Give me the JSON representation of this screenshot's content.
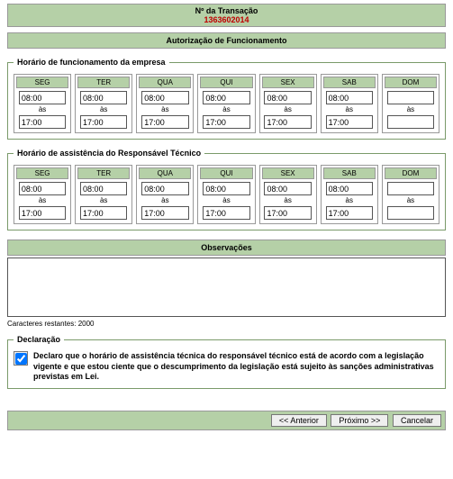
{
  "header": {
    "title": "Nº da Transação",
    "transaction_number": "1363602014"
  },
  "section_title": "Autorização de Funcionamento",
  "schedule_company": {
    "legend": "Horário de funcionamento da empresa",
    "days": [
      "SEG",
      "TER",
      "QUA",
      "QUI",
      "SEX",
      "SAB",
      "DOM"
    ],
    "separator": "às",
    "rows": [
      {
        "start": "08:00",
        "end": "17:00"
      },
      {
        "start": "08:00",
        "end": "17:00"
      },
      {
        "start": "08:00",
        "end": "17:00"
      },
      {
        "start": "08:00",
        "end": "17:00"
      },
      {
        "start": "08:00",
        "end": "17:00"
      },
      {
        "start": "08:00",
        "end": "17:00"
      },
      {
        "start": "",
        "end": ""
      }
    ]
  },
  "schedule_tech": {
    "legend": "Horário de assistência do Responsável Técnico",
    "days": [
      "SEG",
      "TER",
      "QUA",
      "QUI",
      "SEX",
      "SAB",
      "DOM"
    ],
    "separator": "às",
    "rows": [
      {
        "start": "08:00",
        "end": "17:00"
      },
      {
        "start": "08:00",
        "end": "17:00"
      },
      {
        "start": "08:00",
        "end": "17:00"
      },
      {
        "start": "08:00",
        "end": "17:00"
      },
      {
        "start": "08:00",
        "end": "17:00"
      },
      {
        "start": "08:00",
        "end": "17:00"
      },
      {
        "start": "",
        "end": ""
      }
    ]
  },
  "observations": {
    "title": "Observações",
    "value": "",
    "counter_label": "Caracteres restantes: 2000"
  },
  "declaration": {
    "legend": "Declaração",
    "text": "Declaro que o horário de assistência técnica do responsável técnico está de acordo com a legislação vigente e que estou ciente que o descumprimento da legislação está sujeito às sanções administrativas previstas em Lei.",
    "checked": true
  },
  "buttons": {
    "prev": "<< Anterior",
    "next": "Próximo >>",
    "cancel": "Cancelar"
  }
}
